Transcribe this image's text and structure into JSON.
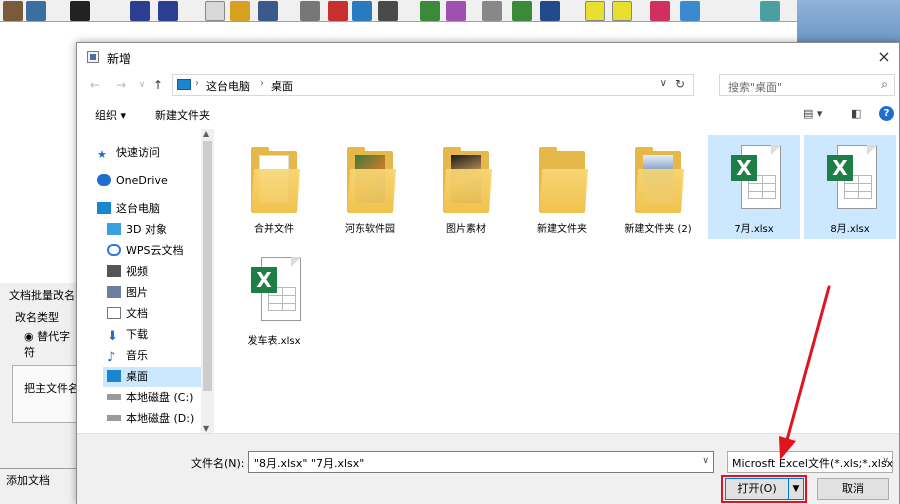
{
  "background_app": {
    "panel_title": "文档批量改名",
    "group_label": "改名类型",
    "radio_label": "替代字符",
    "box_text": "把主文件名",
    "status_text": "添加文档"
  },
  "dialog": {
    "title": "新增",
    "close_glyph": "×",
    "nav": {
      "back": "←",
      "forward": "→",
      "recent": "∨",
      "up": "↑",
      "path": [
        "这台电脑",
        "桌面"
      ],
      "search_placeholder": "搜索\"桌面\""
    },
    "command_bar": {
      "organize": "组织 ▾",
      "new_folder": "新建文件夹",
      "help": "?"
    },
    "nav_pane": [
      {
        "label": "快速访问",
        "icon": "star-icon"
      },
      {
        "label": "OneDrive",
        "icon": "cloud-icon"
      },
      {
        "label": "这台电脑",
        "icon": "computer-icon"
      },
      {
        "label": "3D 对象",
        "icon": "cube-icon"
      },
      {
        "label": "WPS云文档",
        "icon": "wps-cloud-icon"
      },
      {
        "label": "视频",
        "icon": "video-icon"
      },
      {
        "label": "图片",
        "icon": "picture-icon"
      },
      {
        "label": "文档",
        "icon": "document-icon"
      },
      {
        "label": "下载",
        "icon": "download-icon"
      },
      {
        "label": "音乐",
        "icon": "music-icon"
      },
      {
        "label": "桌面",
        "icon": "desktop-icon",
        "selected": true
      },
      {
        "label": "本地磁盘 (C:)",
        "icon": "drive-icon"
      },
      {
        "label": "本地磁盘 (D:)",
        "icon": "drive-icon"
      }
    ],
    "files": [
      {
        "name": "合并文件",
        "kind": "folder",
        "content": "papers"
      },
      {
        "name": "河东软件园",
        "kind": "folder",
        "content": "photo"
      },
      {
        "name": "图片素材",
        "kind": "folder",
        "content": "photo-dark"
      },
      {
        "name": "新建文件夹",
        "kind": "folder",
        "content": "empty"
      },
      {
        "name": "新建文件夹 (2)",
        "kind": "folder",
        "content": "screenshot"
      },
      {
        "name": "7月.xlsx",
        "kind": "xlsx",
        "selected": true
      },
      {
        "name": "8月.xlsx",
        "kind": "xlsx",
        "selected": true
      },
      {
        "name": "发车表.xlsx",
        "kind": "xlsx"
      }
    ],
    "footer": {
      "filename_label": "文件名(N):",
      "filename_value": "\"8月.xlsx\" \"7月.xlsx\"",
      "filter_value": "Microsft Excel文件(*.xls;*.xlsx",
      "open_label": "打开(O)",
      "cancel_label": "取消"
    }
  },
  "colors": {
    "selection": "#cce8ff",
    "excel_green": "#1e7e45",
    "folder_yellow": "#f1c34f",
    "highlight_red": "#e0141e",
    "accent_blue": "#0078d7"
  }
}
